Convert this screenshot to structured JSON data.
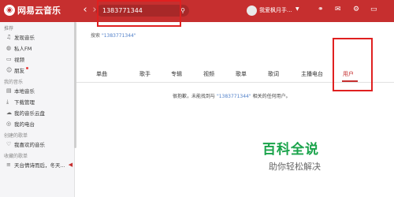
{
  "app": {
    "name": "网易云音乐"
  },
  "topbar": {
    "search_value": "1383771344",
    "username": "我爱枫月手...",
    "icons": [
      "back-arrow-icon",
      "forward-arrow-icon",
      "search-icon",
      "skin-icon",
      "mail-icon",
      "settings-icon",
      "minimize-icon"
    ]
  },
  "sidebar": {
    "sections": [
      {
        "title": "推荐",
        "items": [
          {
            "icon": "music-note-icon",
            "label": "发现音乐"
          },
          {
            "icon": "radio-icon",
            "label": "私人FM"
          },
          {
            "icon": "video-icon",
            "label": "视频"
          },
          {
            "icon": "friends-icon",
            "label": "朋友",
            "badge_dot": true
          }
        ]
      },
      {
        "title": "我的音乐",
        "items": [
          {
            "icon": "local-music-icon",
            "label": "本地音乐"
          },
          {
            "icon": "download-icon",
            "label": "下载管理"
          },
          {
            "icon": "cloud-icon",
            "label": "我的音乐云盘"
          },
          {
            "icon": "radio-station-icon",
            "label": "我的电台"
          }
        ]
      },
      {
        "title": "创建的歌单",
        "items": [
          {
            "icon": "heart-icon",
            "label": "我喜欢的音乐"
          }
        ]
      },
      {
        "title": "收藏的歌单",
        "items": [
          {
            "icon": "playlist-icon",
            "label": "天台情诗而后，冬天...",
            "playing": true
          }
        ]
      }
    ]
  },
  "main": {
    "search_prefix": "搜索",
    "search_query": "\"1383771344\"",
    "tabs": [
      "单曲",
      "歌手",
      "专辑",
      "视频",
      "歌单",
      "歌词",
      "主播电台",
      "用户"
    ],
    "active_tab": "用户",
    "empty_prefix": "很抱歉，未能找到与",
    "empty_query": "\"1383771344\"",
    "empty_suffix": "相关的任何用户。"
  },
  "watermark": {
    "title": "百科全说",
    "subtitle": "助你轻松解决"
  },
  "colors": {
    "brand_red": "#c62f2f",
    "link_blue": "#4e7ec8",
    "highlight_box": "#e02020",
    "watermark_green": "#19a34a"
  }
}
